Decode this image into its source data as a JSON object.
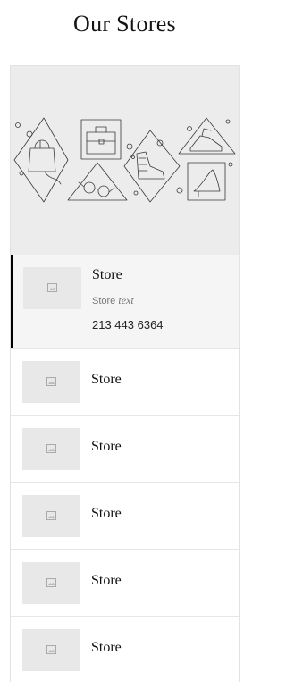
{
  "page": {
    "title": "Our Stores"
  },
  "colors": {
    "hero_bg": "#ececec",
    "active_row_bg": "#f5f5f5",
    "active_indicator": "#000000",
    "thumb_bg": "#e8e8e8"
  },
  "hero": {
    "icon": "hand-drawn-accessories-illustration"
  },
  "stores": [
    {
      "name": "Store",
      "text_prefix": "Store",
      "text_em": "text",
      "phone": "213 443 6364",
      "active": true,
      "thumb_icon": "image-placeholder-icon"
    },
    {
      "name": "Store",
      "active": false,
      "thumb_icon": "image-placeholder-icon"
    },
    {
      "name": "Store",
      "active": false,
      "thumb_icon": "image-placeholder-icon"
    },
    {
      "name": "Store",
      "active": false,
      "thumb_icon": "image-placeholder-icon"
    },
    {
      "name": "Store",
      "active": false,
      "thumb_icon": "image-placeholder-icon"
    },
    {
      "name": "Store",
      "active": false,
      "thumb_icon": "image-placeholder-icon"
    }
  ]
}
